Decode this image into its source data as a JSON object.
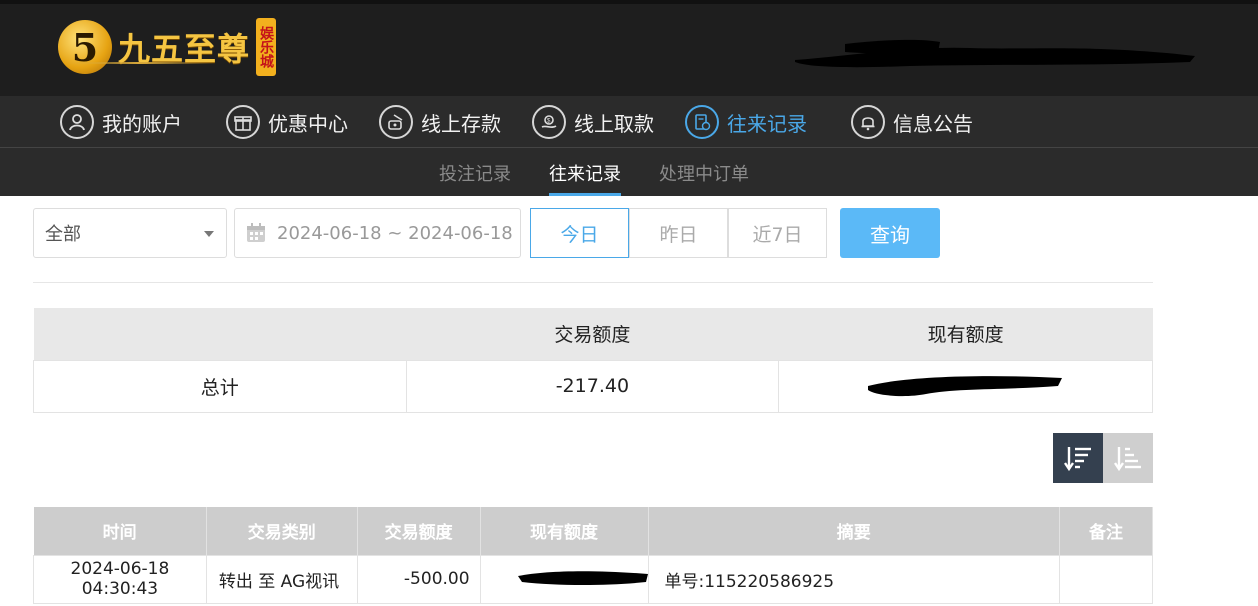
{
  "brand": {
    "name": "九五至尊",
    "digit": "5",
    "stamp": "娱乐城"
  },
  "main_nav": [
    {
      "label": "我的账户",
      "icon": "user-icon"
    },
    {
      "label": "优惠中心",
      "icon": "gift-icon"
    },
    {
      "label": "线上存款",
      "icon": "deposit-icon"
    },
    {
      "label": "线上取款",
      "icon": "withdraw-icon"
    },
    {
      "label": "往来记录",
      "icon": "records-icon",
      "active": true
    },
    {
      "label": "信息公告",
      "icon": "bell-icon"
    }
  ],
  "sub_nav": [
    {
      "label": "投注记录"
    },
    {
      "label": "往来记录",
      "active": true
    },
    {
      "label": "处理中订单"
    }
  ],
  "filters": {
    "type_select": "全部",
    "date_range": "2024-06-18 ~ 2024-06-18",
    "quick_ranges": [
      "今日",
      "昨日",
      "近7日"
    ],
    "active_range": "今日",
    "query_label": "查询"
  },
  "summary": {
    "headers": [
      "",
      "交易额度",
      "现有额度"
    ],
    "row": {
      "label": "总计",
      "amount": "-217.40"
    }
  },
  "detail": {
    "headers": [
      "时间",
      "交易类别",
      "交易额度",
      "现有额度",
      "摘要",
      "备注"
    ],
    "rows": [
      {
        "time": "2024-06-18 04:30:43",
        "type": "转出 至 AG视讯",
        "amount": "-500.00",
        "summary": "单号:115220586925",
        "note": ""
      }
    ]
  },
  "colors": {
    "accent": "#4aa8e8",
    "query_button": "#5bb9f7",
    "header_bg": "#1e1e1e",
    "nav_bg": "#2b2b2b",
    "sort_active": "#34404f"
  }
}
